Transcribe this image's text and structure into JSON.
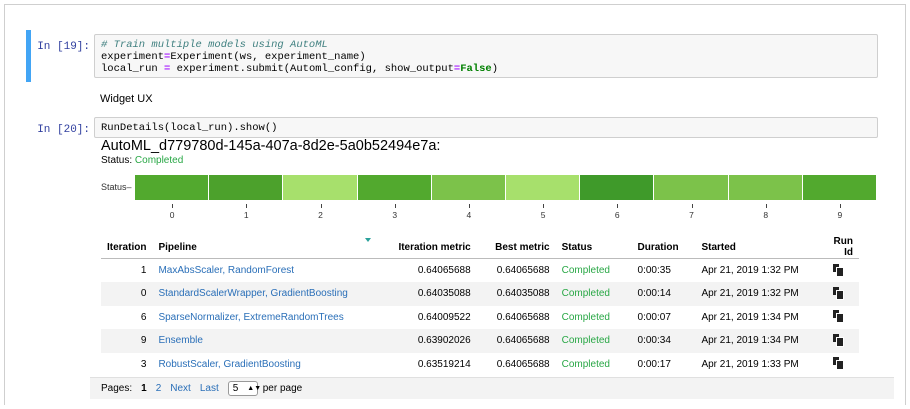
{
  "cells": [
    {
      "prompt": "In [19]:",
      "code_lines": [
        [
          {
            "t": "# Train multiple models using AutoML",
            "c": "cm-comment"
          }
        ],
        [
          {
            "t": "experiment",
            "c": ""
          },
          {
            "t": "=",
            "c": "cm-op"
          },
          {
            "t": "Experiment(ws, experiment_name)",
            "c": ""
          }
        ],
        [
          {
            "t": "local_run ",
            "c": ""
          },
          {
            "t": "=",
            "c": "cm-op"
          },
          {
            "t": " experiment.submit(Automl_config, show_output",
            "c": ""
          },
          {
            "t": "=",
            "c": "cm-op"
          },
          {
            "t": "False",
            "c": "cm-kw"
          },
          {
            "t": ")",
            "c": ""
          }
        ]
      ]
    },
    {
      "prompt": "In [20]:",
      "code_lines": [
        [
          {
            "t": "RunDetails(local_run).show()",
            "c": ""
          }
        ]
      ]
    }
  ],
  "markdown_text": "Widget UX",
  "widget": {
    "run_id": "AutoML_d779780d-145a-407a-8d2e-5a0b52494e7a:",
    "status_label": "Status: ",
    "status_value": "Completed",
    "chart_ylabel": "Status",
    "chart_ticks": [
      "0",
      "1",
      "2",
      "3",
      "4",
      "5",
      "6",
      "7",
      "8",
      "9"
    ],
    "chart_colors": [
      "#52a92e",
      "#4ca12c",
      "#a7e06c",
      "#52a92e",
      "#7cc24a",
      "#a7e06c",
      "#3f9a2a",
      "#7cc24a",
      "#7cc24a",
      "#52a92e"
    ]
  },
  "table": {
    "columns": [
      "Iteration",
      "Pipeline",
      "Iteration metric",
      "Best metric",
      "Status",
      "Duration",
      "Started",
      "Run Id"
    ],
    "rows": [
      {
        "iteration": "1",
        "pipeline": "MaxAbsScaler, RandomForest",
        "iter_metric": "0.64065688",
        "best_metric": "0.64065688",
        "status": "Completed",
        "duration": "0:00:35",
        "started": "Apr 21, 2019 1:32 PM"
      },
      {
        "iteration": "0",
        "pipeline": "StandardScalerWrapper, GradientBoosting",
        "iter_metric": "0.64035088",
        "best_metric": "0.64035088",
        "status": "Completed",
        "duration": "0:00:14",
        "started": "Apr 21, 2019 1:32 PM"
      },
      {
        "iteration": "6",
        "pipeline": "SparseNormalizer, ExtremeRandomTrees",
        "iter_metric": "0.64009522",
        "best_metric": "0.64065688",
        "status": "Completed",
        "duration": "0:00:07",
        "started": "Apr 21, 2019 1:34 PM"
      },
      {
        "iteration": "9",
        "pipeline": "Ensemble",
        "iter_metric": "0.63902026",
        "best_metric": "0.64065688",
        "status": "Completed",
        "duration": "0:00:34",
        "started": "Apr 21, 2019 1:34 PM"
      },
      {
        "iteration": "3",
        "pipeline": "RobustScaler, GradientBoosting",
        "iter_metric": "0.63519214",
        "best_metric": "0.64065688",
        "status": "Completed",
        "duration": "0:00:17",
        "started": "Apr 21, 2019 1:33 PM"
      }
    ],
    "run_id_icon": "copy-icon"
  },
  "pager": {
    "label": "Pages:",
    "current": "1",
    "page2": "2",
    "next": "Next",
    "last": "Last",
    "page_size": "5",
    "per_page": "per page"
  }
}
